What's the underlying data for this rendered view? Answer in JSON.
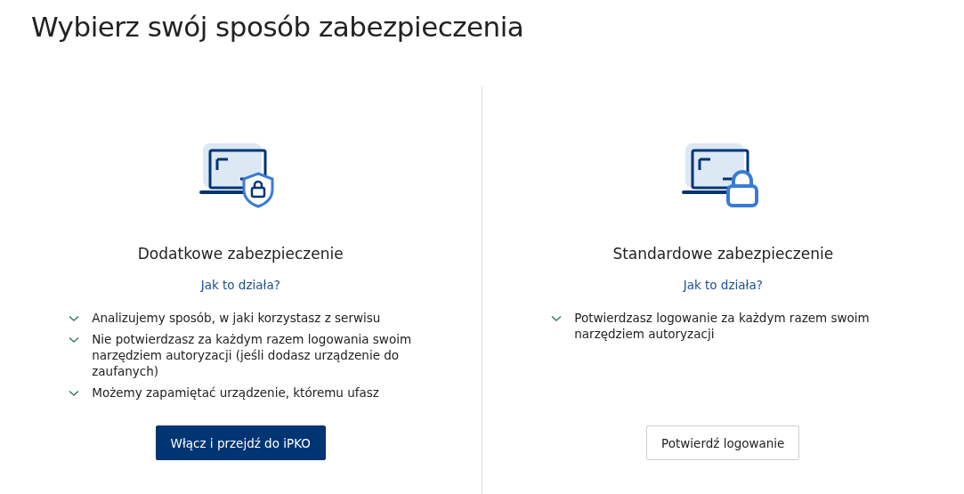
{
  "title": "Wybierz swój sposób zabezpieczenia",
  "options": [
    {
      "kind": "shield",
      "heading": "Dodatkowe zabezpieczenie",
      "link": "Jak to działa?",
      "features": [
        "Analizujemy sposób, w jaki korzystasz z serwisu",
        "Nie potwierdzasz za każdym razem logowania swoim narzędziem autoryzacji (jeśli dodasz urządzenie do zaufanych)",
        "Możemy zapamiętać urządzenie, któremu ufasz"
      ],
      "button": {
        "label": "Włącz i przejdź do iPKO",
        "kind": "primary"
      }
    },
    {
      "kind": "lock",
      "heading": "Standardowe zabezpieczenie",
      "link": "Jak to działa?",
      "features": [
        "Potwierdzasz logowanie za każdym razem swoim narzędziem autoryzacji"
      ],
      "button": {
        "label": "Potwierdź logowanie",
        "kind": "secondary"
      }
    }
  ]
}
